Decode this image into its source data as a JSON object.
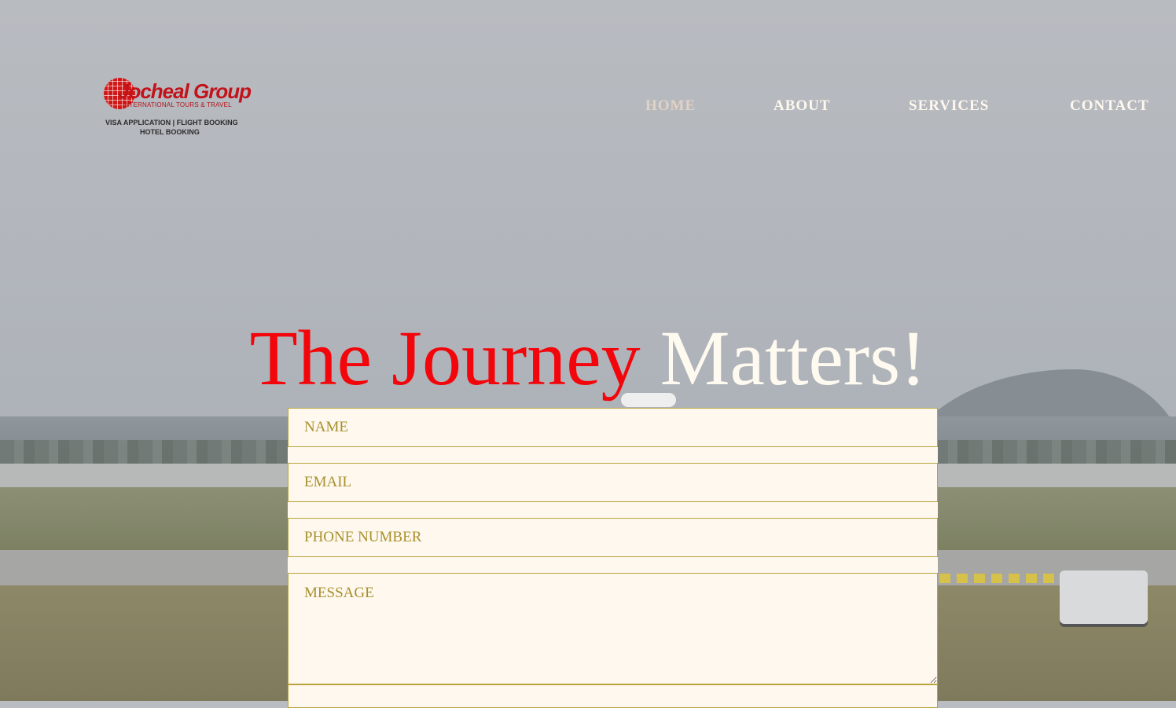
{
  "logo": {
    "title": "Jocheal Group",
    "subtitle": "INTERNATIONAL TOURS & TRAVEL",
    "line1": "VISA APPLICATION | FLIGHT BOOKING",
    "line2": "HOTEL BOOKING",
    "icon": "globe-icon"
  },
  "nav": {
    "items": [
      {
        "label": "HOME",
        "active": true
      },
      {
        "label": "ABOUT",
        "active": false
      },
      {
        "label": "SERVICES",
        "active": false
      },
      {
        "label": "CONTACT",
        "active": false
      }
    ]
  },
  "hero": {
    "part1": "The Journey",
    "part2": "Matters!"
  },
  "form": {
    "name_placeholder": "NAME",
    "email_placeholder": "EMAIL",
    "phone_placeholder": "PHONE NUMBER",
    "message_placeholder": "MESSAGE"
  },
  "colors": {
    "accent_red": "#f2060b",
    "field_bg": "#fff8ee",
    "field_border": "#b7a43c",
    "field_text": "#a8902c"
  }
}
